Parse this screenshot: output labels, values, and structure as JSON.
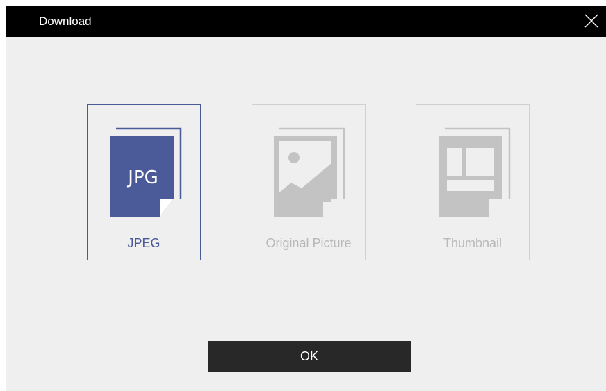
{
  "window": {
    "title": "Download"
  },
  "options": [
    {
      "label": "JPEG",
      "icon_text": "JPG",
      "icon": "jpg-file-icon",
      "state": "selected"
    },
    {
      "label": "Original Picture",
      "icon": "image-file-icon",
      "state": "disabled"
    },
    {
      "label": "Thumbnail",
      "icon": "thumbnail-file-icon",
      "state": "disabled"
    }
  ],
  "actions": {
    "ok_label": "OK"
  },
  "colors": {
    "titlebar": "#000000",
    "background": "#efefef",
    "accent": "#4b5b9a",
    "disabled": "#c3c3c3",
    "ok_button": "#282828"
  }
}
